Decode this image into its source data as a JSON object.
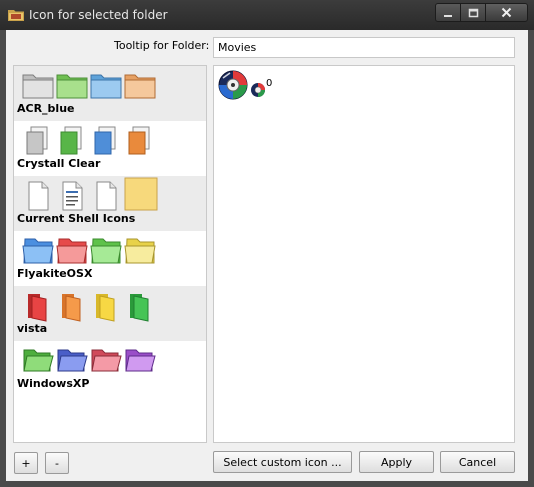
{
  "window": {
    "title": "Icon for selected folder"
  },
  "tooltip": {
    "label": "Tooltip for Folder:",
    "value": "Movies"
  },
  "icon_sets": [
    {
      "name": "ACR_blue",
      "icons": [
        "gray-folder-icon",
        "green-folder-icon",
        "blue-folder-icon",
        "orange-folder-icon"
      ]
    },
    {
      "name": "Crystall Clear",
      "icons": [
        "gray-document-icon",
        "green-document-icon",
        "blue-document-icon",
        "orange-document-icon"
      ]
    },
    {
      "name": "Current Shell Icons",
      "icons": [
        "blank-file-icon",
        "text-file-icon",
        "blank-file-icon",
        "yellow-folder-icon"
      ]
    },
    {
      "name": "FlyakiteOSX",
      "icons": [
        "blue-folder-icon",
        "red-folder-icon",
        "green-folder-icon",
        "yellow-folder-icon"
      ]
    },
    {
      "name": "vista",
      "icons": [
        "red-folder-icon",
        "orange-folder-icon",
        "yellow-folder-icon",
        "green-folder-icon"
      ]
    },
    {
      "name": "WindowsXP",
      "icons": [
        "green-folder-icon",
        "blue-folder-icon",
        "red-folder-icon",
        "purple-folder-icon"
      ]
    }
  ],
  "selected": {
    "index": "0",
    "icon": "disc-icon"
  },
  "buttons": {
    "add": "+",
    "remove": "-",
    "custom": "Select custom icon ...",
    "apply": "Apply",
    "cancel": "Cancel"
  }
}
